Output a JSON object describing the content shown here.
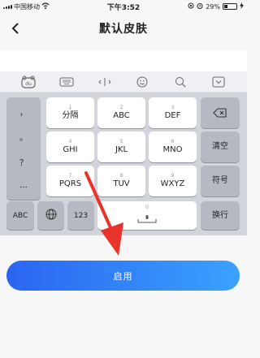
{
  "status_bar": {
    "carrier": "中国移动",
    "time": "下午3:52",
    "battery": "29%"
  },
  "nav": {
    "title": "默认皮肤"
  },
  "toolbar": {
    "icons": [
      "du-logo-icon",
      "keyboard-icon",
      "cursor-move-icon",
      "emoji-icon",
      "search-icon",
      "hide-keyboard-icon"
    ]
  },
  "keyboard": {
    "punctuation": [
      "，",
      "。",
      "？",
      "…"
    ],
    "rows": [
      [
        {
          "num": "1",
          "label": "分隔"
        },
        {
          "num": "2",
          "label": "ABC"
        },
        {
          "num": "3",
          "label": "DEF"
        }
      ],
      [
        {
          "num": "4",
          "label": "GHI"
        },
        {
          "num": "5",
          "label": "JKL"
        },
        {
          "num": "6",
          "label": "MNO"
        }
      ],
      [
        {
          "num": "7",
          "label": "PQRS"
        },
        {
          "num": "8",
          "label": "TUV"
        },
        {
          "num": "9",
          "label": "WXYZ"
        }
      ]
    ],
    "clear_label": "清空",
    "symbol_label": "符号",
    "abc_label": "ABC",
    "num_label": "123",
    "space_num": "0",
    "return_label": "换行"
  },
  "enable_button_label": "启用",
  "colors": {
    "button_start": "#2b64f0",
    "button_end": "#3aa2ff",
    "arrow": "#e8332a",
    "keyboard_bg": "#d1d5db"
  }
}
